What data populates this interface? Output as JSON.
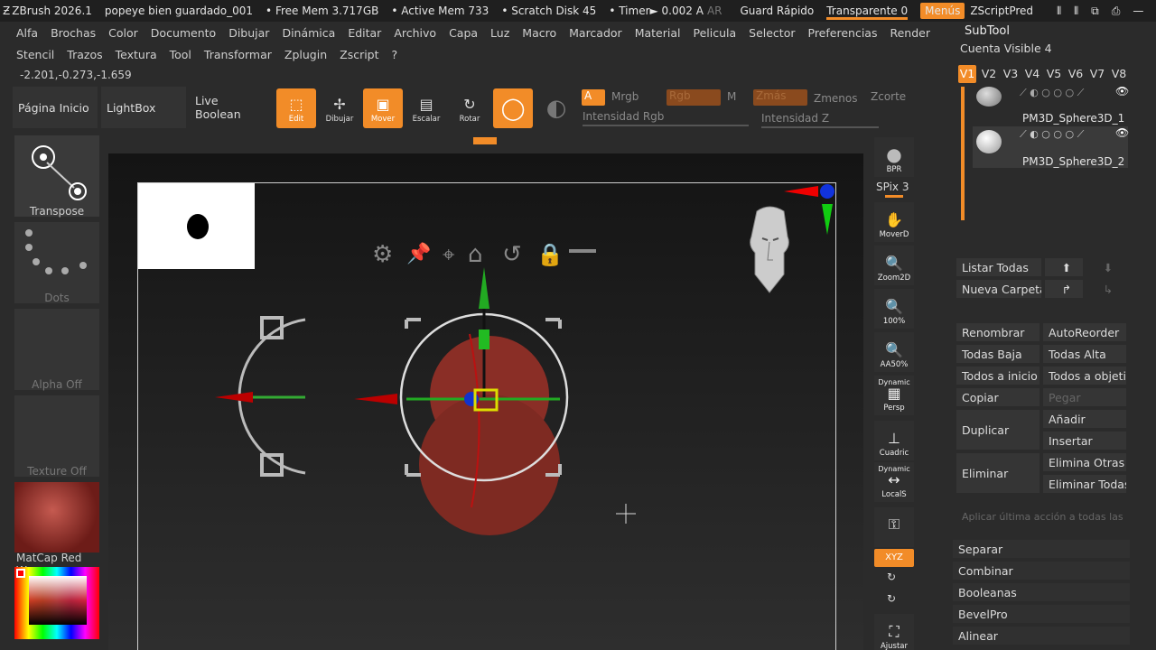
{
  "title_bar": {
    "app": "ZBrush 2026.1",
    "file": "popeye bien guardado_001",
    "free_mem": "• Free Mem 3.717GB",
    "active_mem": "• Active Mem 733",
    "scratch": "• Scratch Disk 45",
    "timer": "• Timer► 0.002 A",
    "ar": "AR",
    "guard": "Guard Rápido",
    "transparente": "Transparente 0",
    "menus": "Menús",
    "zscript": "ZScriptPred"
  },
  "menu_row1": [
    "Alfa",
    "Brochas",
    "Color",
    "Documento",
    "Dibujar",
    "Dinámica",
    "Editar",
    "Archivo",
    "Capa",
    "Luz",
    "Macro",
    "Marcador",
    "Material",
    "Pelicula",
    "Selector",
    "Preferencias",
    "Render"
  ],
  "menu_row2": [
    "Stencil",
    "Trazos",
    "Textura",
    "Tool",
    "Transformar",
    "Zplugin",
    "Zscript",
    "?"
  ],
  "coords": "-2.201,-0.273,-1.659",
  "shelf": {
    "home": "Página Inicio",
    "lightbox": "LightBox",
    "live_boolean": "Live Boolean",
    "edit": "Edit",
    "dibujar": "Dibujar",
    "mover": "Mover",
    "escalar": "Escalar",
    "rotar": "Rotar",
    "a": "A",
    "mrgb": "Mrgb",
    "rgb": "Rgb",
    "m": "M",
    "zmas": "Zmás",
    "zmenos": "Zmenos",
    "zcorte": "Zcorte",
    "intensidad_rgb": "Intensidad Rgb",
    "intensidad_z": "Intensidad Z"
  },
  "left_panel": {
    "transpose": "Transpose",
    "dots": "Dots",
    "alpha": "Alpha Off",
    "texture": "Texture Off",
    "material": "MatCap Red Wax"
  },
  "right_column": {
    "bpr": "BPR",
    "spix": "SPix 3",
    "mover": "MoverD",
    "zoom": "Zoom2D",
    "pct": "100%",
    "aa": "AA50%",
    "dynamic1": "Dynamic",
    "persp": "Persp",
    "cuadric": "Cuadric",
    "dynamic2": "Dynamic",
    "locals": "LocalS",
    "xyz": "XYZ",
    "ajustar": "Ajustar"
  },
  "subtool": {
    "title": "SubTool",
    "visible": "Cuenta Visible 4",
    "versions": [
      "V1",
      "V2",
      "V3",
      "V4",
      "V5",
      "V6",
      "V7",
      "V8"
    ],
    "items": [
      "PM3D_Sphere3D_1",
      "PM3D_Sphere3D_2"
    ],
    "listar": "Listar Todas",
    "nueva": "Nueva Carpeta",
    "renombrar": "Renombrar",
    "autoreorder": "AutoReorder",
    "todas_baja": "Todas Baja",
    "todas_alta": "Todas Alta",
    "todos_inicio": "Todos a inicio",
    "todos_objetivo": "Todos a objetivo",
    "copiar": "Copiar",
    "pegar": "Pegar",
    "duplicar": "Duplicar",
    "anadir": "Añadir",
    "insertar": "Insertar",
    "eliminar": "Eliminar",
    "elimina_otras": "Elimina Otras",
    "eliminar_todas": "Eliminar Todas",
    "aplicar": "Aplicar última acción a todas las",
    "separar": "Separar",
    "combinar": "Combinar",
    "booleanas": "Booleanas",
    "bevelpro": "BevelPro",
    "alinear": "Alinear"
  },
  "colors": {
    "accent": "#f28c28",
    "bg": "#2b2b2b"
  }
}
